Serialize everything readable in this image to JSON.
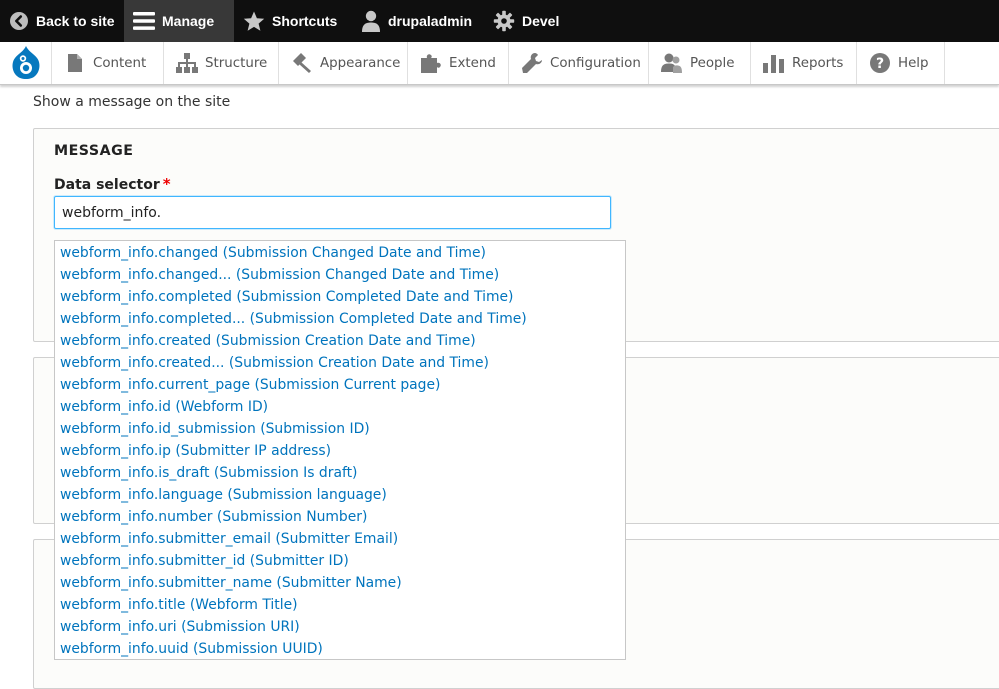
{
  "toolbar": {
    "back_label": "Back to site",
    "manage_label": "Manage",
    "shortcuts_label": "Shortcuts",
    "user_label": "drupaladmin",
    "devel_label": "Devel"
  },
  "tray": {
    "items": [
      {
        "label": "Content",
        "icon": "file-icon"
      },
      {
        "label": "Structure",
        "icon": "sitemap-icon"
      },
      {
        "label": "Appearance",
        "icon": "paintbrush-icon"
      },
      {
        "label": "Extend",
        "icon": "puzzle-icon"
      },
      {
        "label": "Configuration",
        "icon": "wrench-icon"
      },
      {
        "label": "People",
        "icon": "people-icon"
      },
      {
        "label": "Reports",
        "icon": "bar-chart-icon"
      },
      {
        "label": "Help",
        "icon": "help-icon"
      }
    ]
  },
  "page": {
    "description": "Show a message on the site"
  },
  "form": {
    "legend": "MESSAGE",
    "data_selector_label": "Data selector",
    "required_marker": "*",
    "data_selector_value": "webform_info."
  },
  "autocomplete": {
    "items": [
      "webform_info.changed (Submission Changed Date and Time)",
      "webform_info.changed... (Submission Changed Date and Time)",
      "webform_info.completed (Submission Completed Date and Time)",
      "webform_info.completed... (Submission Completed Date and Time)",
      "webform_info.created (Submission Creation Date and Time)",
      "webform_info.created... (Submission Creation Date and Time)",
      "webform_info.current_page (Submission Current page)",
      "webform_info.id (Webform ID)",
      "webform_info.id_submission (Submission ID)",
      "webform_info.ip (Submitter IP address)",
      "webform_info.is_draft (Submission Is draft)",
      "webform_info.language (Submission language)",
      "webform_info.number (Submission Number)",
      "webform_info.submitter_email (Submitter Email)",
      "webform_info.submitter_id (Submitter ID)",
      "webform_info.submitter_name (Submitter Name)",
      "webform_info.title (Webform Title)",
      "webform_info.uri (Submission URI)",
      "webform_info.uuid (Submission UUID)"
    ]
  },
  "colors": {
    "toolbar_bg": "#0f0f0f",
    "active_tab_bg": "#383838",
    "link_blue": "#0074bd",
    "focus_blue": "#40b6ff",
    "required_red": "#ee0000"
  }
}
